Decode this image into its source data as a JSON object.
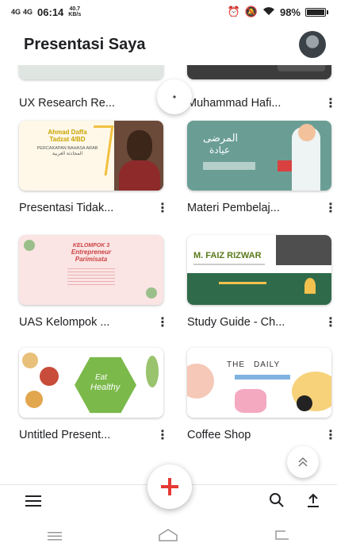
{
  "status_bar": {
    "signal_1": "4G",
    "signal_2": "4G",
    "time": "06:14",
    "speed_value": "40.7",
    "speed_unit": "KB/s",
    "battery_percent": "98%"
  },
  "app_bar": {
    "title": "Presentasi Saya"
  },
  "presentations": [
    {
      "title": "UX Research Re..."
    },
    {
      "title": "Muhammad Hafi..."
    },
    {
      "title": "Presentasi Tidak..."
    },
    {
      "title": "Materi Pembelaj..."
    },
    {
      "title": "UAS Kelompok ..."
    },
    {
      "title": "Study Guide - Ch..."
    },
    {
      "title": "Untitled Present..."
    },
    {
      "title": "Coffee Shop"
    }
  ],
  "thumbnails": {
    "pres_line1": "Ahmad Daffa",
    "pres_line2": "Tadzat 4/BD",
    "pres_line3": "PERCAKAPAN BAHASA ARAB",
    "pres_line4": "المحادثة العربية",
    "materi_arabic_1": "المرضى",
    "materi_arabic_2": "عيادة",
    "uas_title_1": "KELOMPOK 3",
    "uas_title_2": "Entrepreneur",
    "uas_title_3": "Parimisata",
    "study_name": "M. FAIZ RIZWAR",
    "untitled_text_1": "Eat",
    "untitled_text_2": "Healthy",
    "coffee_text_1": "THE",
    "coffee_text_2": "DAILY"
  },
  "fab": {
    "icon": "plus-icon"
  },
  "bottom_bar": {
    "menu_icon": "menu-icon",
    "search_icon": "search-icon",
    "upload_icon": "upload-icon"
  },
  "colors": {
    "accent": "#e53935",
    "text": "#202124"
  }
}
